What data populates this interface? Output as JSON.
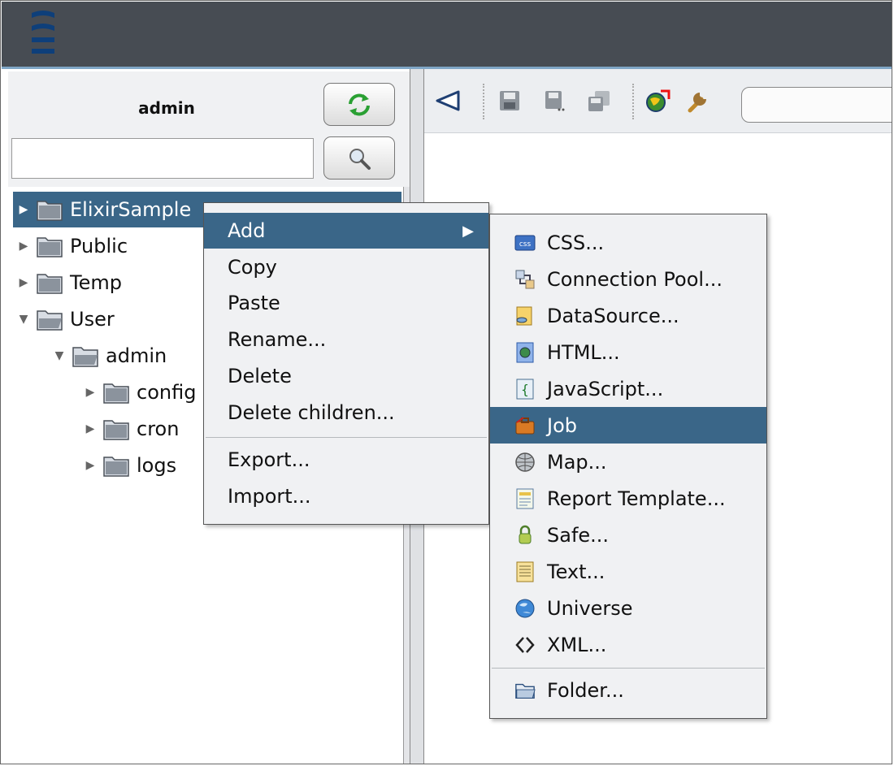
{
  "left": {
    "user": "admin",
    "search": {
      "value": "",
      "placeholder": ""
    },
    "tree": [
      {
        "label": "ElixirSample",
        "depth": 0,
        "expanded": false,
        "selected": true
      },
      {
        "label": "Public",
        "depth": 0,
        "expanded": false,
        "selected": false
      },
      {
        "label": "Temp",
        "depth": 0,
        "expanded": false,
        "selected": false
      },
      {
        "label": "User",
        "depth": 0,
        "expanded": true,
        "selected": false
      },
      {
        "label": "admin",
        "depth": 1,
        "expanded": true,
        "selected": false
      },
      {
        "label": "config",
        "depth": 2,
        "expanded": false,
        "selected": false
      },
      {
        "label": "cron",
        "depth": 2,
        "expanded": false,
        "selected": false
      },
      {
        "label": "logs",
        "depth": 2,
        "expanded": false,
        "selected": false
      }
    ]
  },
  "context_menu": {
    "items": [
      {
        "label": "Add",
        "has_submenu": true,
        "active": true
      },
      {
        "label": "Copy"
      },
      {
        "label": "Paste"
      },
      {
        "label": "Rename..."
      },
      {
        "label": "Delete"
      },
      {
        "label": "Delete children..."
      },
      {
        "label": "Export..."
      },
      {
        "label": "Import..."
      }
    ]
  },
  "add_submenu": {
    "items": [
      {
        "label": "CSS...",
        "icon": "css-icon"
      },
      {
        "label": "Connection Pool...",
        "icon": "connection-pool-icon"
      },
      {
        "label": "DataSource...",
        "icon": "datasource-icon"
      },
      {
        "label": "HTML...",
        "icon": "html-icon"
      },
      {
        "label": "JavaScript...",
        "icon": "javascript-icon"
      },
      {
        "label": "Job",
        "icon": "job-briefcase-icon",
        "active": true
      },
      {
        "label": "Map...",
        "icon": "map-globe-icon"
      },
      {
        "label": "Report Template...",
        "icon": "report-template-icon"
      },
      {
        "label": "Safe...",
        "icon": "safe-lock-icon"
      },
      {
        "label": "Text...",
        "icon": "text-file-icon"
      },
      {
        "label": "Universe",
        "icon": "universe-icon"
      },
      {
        "label": "XML...",
        "icon": "xml-icon"
      },
      {
        "label": "Folder...",
        "icon": "folder-icon"
      }
    ]
  },
  "colors": {
    "header": "#474c53",
    "selection": "#3a6688",
    "menu_bg": "#f0f1f3"
  }
}
